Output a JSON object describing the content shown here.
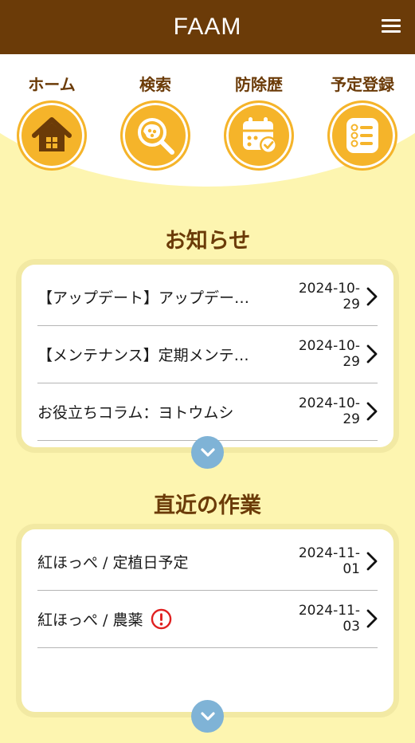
{
  "app": {
    "logo": "FAAM"
  },
  "nav": [
    {
      "label": "ホーム",
      "icon": "house-icon"
    },
    {
      "label": "検索",
      "icon": "bug-search-icon"
    },
    {
      "label": "防除歴",
      "icon": "calendar-check-icon"
    },
    {
      "label": "予定登録",
      "icon": "checklist-icon"
    }
  ],
  "notices": {
    "title": "お知らせ",
    "items": [
      {
        "title": "【アップデート】アップデー…",
        "date": "2024-10-29"
      },
      {
        "title": "【メンテナンス】定期メンテ…",
        "date": "2024-10-29"
      },
      {
        "title": "お役立ちコラム：ヨトウムシ",
        "date": "2024-10-29"
      }
    ]
  },
  "tasks": {
    "title": "直近の作業",
    "items": [
      {
        "title": "紅ほっぺ / 定植日予定",
        "date": "2024-11-01",
        "warning": false
      },
      {
        "title": "紅ほっぺ / 農薬",
        "date": "2024-11-03",
        "warning": true
      }
    ]
  },
  "colors": {
    "brand_brown": "#6b3b08",
    "accent_orange": "#f5b42a",
    "background_yellow": "#fdf5b0",
    "expand_blue": "#7fb3d6",
    "warning_red": "#e02020"
  }
}
